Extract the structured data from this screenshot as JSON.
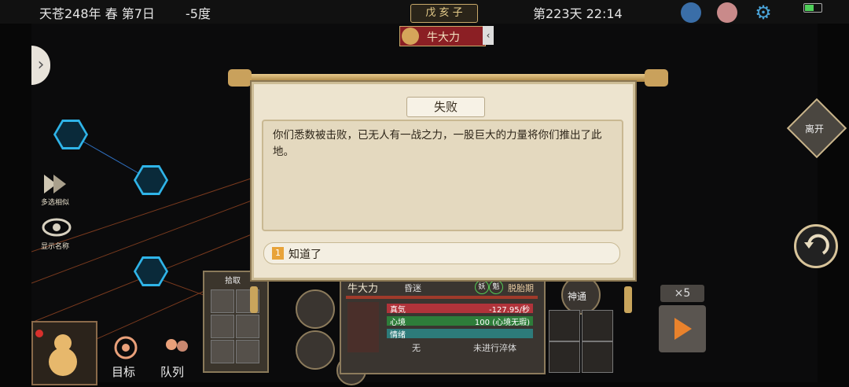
{
  "topbar": {
    "date": "天苍248年 春 第7日",
    "temperature": "-5度",
    "ganzhi": "戊 亥 子",
    "day_time": "第223天 22:14"
  },
  "character_tag": {
    "name": "牛大力"
  },
  "left_menu": {
    "multi_select_label": "多选相似",
    "show_names_label": "显示名称"
  },
  "dialog": {
    "title": "失败",
    "message": "你们悉数被击败，已无人有一战之力，一股巨大的力量将你们推出了此地。",
    "option_number": "1",
    "option_label": "知道了"
  },
  "pickup": {
    "title": "拾取"
  },
  "status": {
    "name": "牛大力",
    "state": "昏迷",
    "badges": [
      "妖",
      "魁"
    ],
    "phase": "脱胎期",
    "bars": [
      {
        "label": "真気",
        "value": "-127.95/秒",
        "color": "#b0333a"
      },
      {
        "label": "心境",
        "value": "100 (心境无瑕)",
        "color": "#2e7d3a"
      },
      {
        "label": "情绪",
        "value": "",
        "color": "#2d7b7a"
      }
    ],
    "body_label": "无",
    "body_note": "未进行淬体"
  },
  "right_panel": {
    "shentong_label": "神通",
    "speed": "×5",
    "leave_label": "离开"
  },
  "bottom": {
    "target_label": "目标",
    "queue_label": "队列"
  },
  "colors": {
    "accent_blue": "#2fb4e8",
    "dialog_bg": "#ede4cf",
    "play_orange": "#e9822c"
  }
}
